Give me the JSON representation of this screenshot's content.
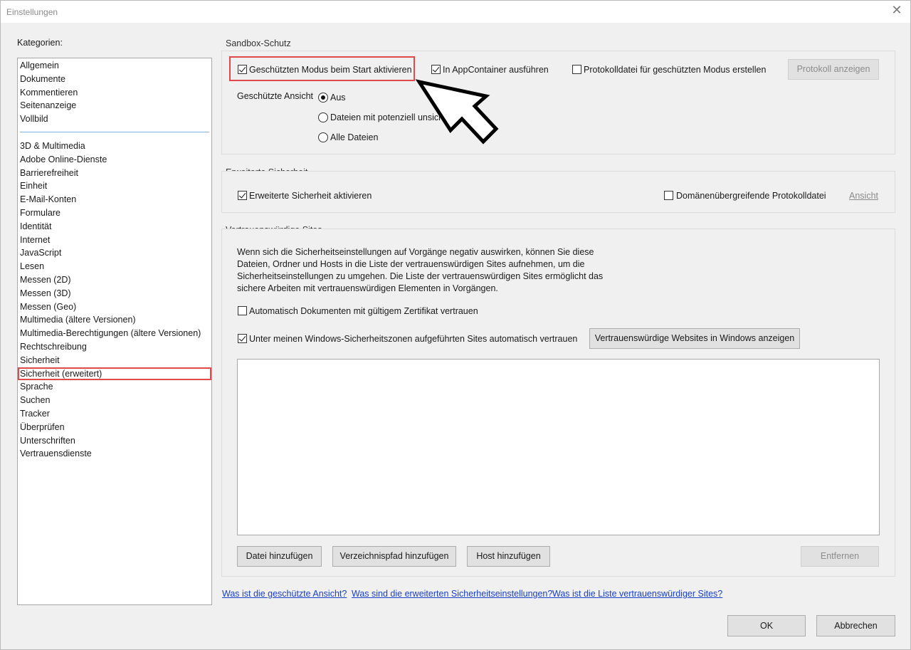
{
  "window": {
    "title": "Einstellungen",
    "close_glyph": "✕"
  },
  "categories": {
    "label": "Kategorien:",
    "group1": [
      "Allgemein",
      "Dokumente",
      "Kommentieren",
      "Seitenanzeige",
      "Vollbild"
    ],
    "group2": [
      "3D & Multimedia",
      "Adobe Online-Dienste",
      "Barrierefreiheit",
      "Einheit",
      "E-Mail-Konten",
      "Formulare",
      "Identität",
      "Internet",
      "JavaScript",
      "Lesen",
      "Messen (2D)",
      "Messen (3D)",
      "Messen (Geo)",
      "Multimedia (ältere Versionen)",
      "Multimedia-Berechtigungen (ältere Versionen)",
      "Rechtschreibung",
      "Sicherheit",
      "Sicherheit (erweitert)",
      "Sprache",
      "Suchen",
      "Tracker",
      "Überprüfen",
      "Unterschriften",
      "Vertrauensdienste"
    ],
    "selected": "Sicherheit (erweitert)"
  },
  "sandbox": {
    "title": "Sandbox-Schutz",
    "protected_mode": {
      "label": "Geschützten Modus beim Start aktivieren",
      "checked": true
    },
    "appcontainer": {
      "label": "In AppContainer ausführen",
      "checked": true
    },
    "logfile": {
      "label": "Protokolldatei für geschützten Modus erstellen",
      "checked": false
    },
    "show_log_button": "Protokoll anzeigen",
    "protected_view_label": "Geschützte Ansicht",
    "radio_off": "Aus",
    "radio_unsafe": "Dateien mit potenziell unsiche",
    "radio_all": "Alle Dateien"
  },
  "enhanced": {
    "title": "Erweiterte Sicherheit",
    "enable": {
      "label": "Erweiterte Sicherheit aktivieren",
      "checked": true
    },
    "cross_domain": {
      "label": "Domänenübergreifende Protokolldatei",
      "checked": false
    },
    "view_link": "Ansicht"
  },
  "trusted": {
    "title": "Vertrauenswürdige Sites",
    "description_lines": [
      "Wenn sich die Sicherheitseinstellungen auf Vorgänge negativ auswirken,  können Sie diese",
      "Dateien, Ordner und Hosts in die Liste der vertrauenswürdigen Sites aufnehmen, um die",
      "Sicherheitseinstellungen zu umgehen. Die Liste der vertrauenswürdigen Sites ermöglicht das",
      "sichere Arbeiten mit vertrauenswürdigen Elementen in Vorgängen."
    ],
    "auto_cert": {
      "label": "Automatisch Dokumenten mit gültigem Zertifikat vertrauen",
      "checked": false
    },
    "win_zones": {
      "label": "Unter meinen Windows-Sicherheitszonen aufgeführten Sites automatisch vertrauen",
      "checked": true
    },
    "show_windows_sites_button": "Vertrauenswürdige Websites in Windows anzeigen",
    "add_file_button": "Datei hinzufügen",
    "add_folder_button": "Verzeichnispfad hinzufügen",
    "add_host_button": "Host hinzufügen",
    "remove_button": "Entfernen"
  },
  "help_links": {
    "protected_view": "Was ist die geschützte Ansicht?",
    "enhanced_security": "Was sind die erweiterten Sicherheitseinstellungen?",
    "trusted_sites": "Was ist die Liste vertrauenswürdiger Sites?"
  },
  "footer": {
    "ok": "OK",
    "cancel": "Abbrechen"
  },
  "colors": {
    "highlight": "#e04a4a",
    "link": "#1a40c8",
    "separator": "#7fb2e0"
  }
}
